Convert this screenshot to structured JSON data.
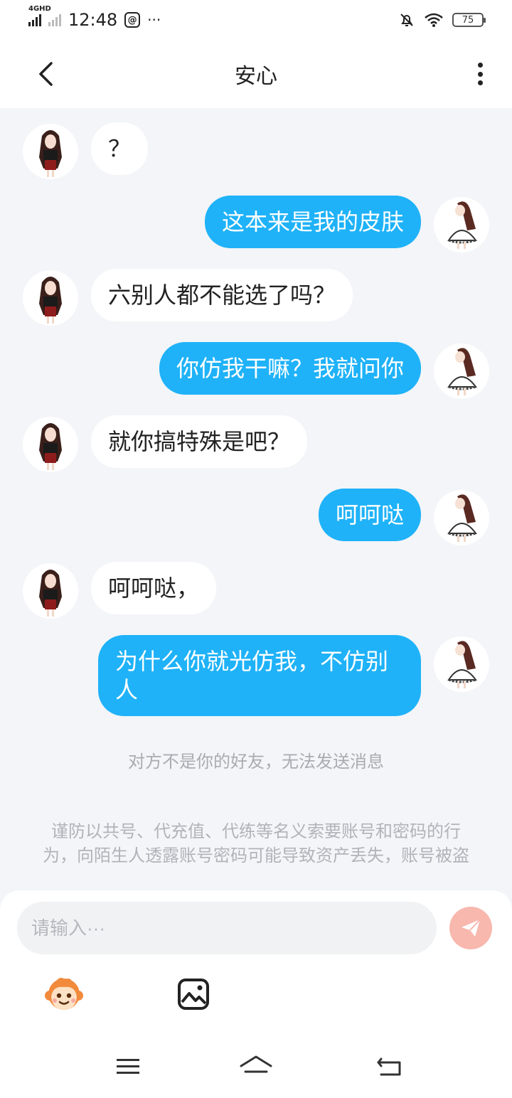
{
  "status_bar": {
    "network": "4GHD",
    "time": "12:48",
    "more": "···",
    "battery": "75"
  },
  "header": {
    "title": "安心"
  },
  "messages": [
    {
      "direction": "in",
      "text": "？"
    },
    {
      "direction": "out",
      "text": "这本来是我的皮肤"
    },
    {
      "direction": "in",
      "text": "六别人都不能选了吗？"
    },
    {
      "direction": "out",
      "text": "你仿我干嘛？我就问你"
    },
    {
      "direction": "in",
      "text": "就你搞特殊是吧？"
    },
    {
      "direction": "out",
      "text": "呵呵哒"
    },
    {
      "direction": "in",
      "text": "呵呵哒，"
    },
    {
      "direction": "out",
      "text": "为什么你就光仿我，不仿别人"
    }
  ],
  "system_notice": "对方不是你的好友，无法发送消息",
  "safety_warning": "谨防以共号、代充值、代练等名义索要账号和密码的行为，向陌生人透露账号密码可能导致资产丢失，账号被盗",
  "composer": {
    "placeholder": "请输入···"
  },
  "colors": {
    "outgoing_bubble": "#1fb2f8",
    "incoming_bubble": "#ffffff",
    "background": "#f3f5f8",
    "send_button": "#f8b8ae"
  },
  "icons": {
    "back": "chevron-left-icon",
    "more": "vertical-dots-icon",
    "send": "paper-plane-icon",
    "emoji": "monkey-face-icon",
    "image": "image-icon",
    "nav_menu": "hamburger-icon",
    "nav_home": "home-icon",
    "nav_back": "return-icon"
  }
}
